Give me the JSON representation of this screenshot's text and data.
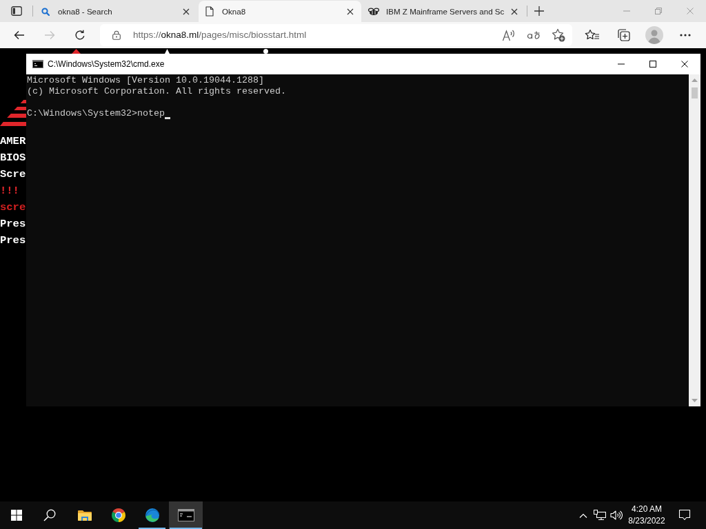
{
  "browser": {
    "tabs": [
      {
        "kind": "search",
        "title": "okna8 - Search",
        "selected": false
      },
      {
        "kind": "page",
        "title": "Okna8",
        "selected": true
      },
      {
        "kind": "site",
        "title": "IBM Z Mainframe Servers and Sc",
        "selected": false
      }
    ],
    "nav_buttons": [
      {
        "kind": "back",
        "disabled": false
      },
      {
        "kind": "forward",
        "disabled": true
      },
      {
        "kind": "refresh",
        "disabled": false
      }
    ],
    "address": {
      "scheme": "https://",
      "host": "okna8.ml",
      "path": "/pages/misc/biosstart.html"
    }
  },
  "page": {
    "lines": [
      {
        "text": "AMER",
        "color": "#ffffff"
      },
      {
        "text": "BIOS",
        "color": "#ffffff"
      },
      {
        "text": "Scre",
        "color": "#ffffff"
      },
      {
        "text": "!!!",
        "color": "#e0262b"
      },
      {
        "text": "scre",
        "color": "#d42020"
      },
      {
        "text": "Pres",
        "color": "#ffffff"
      },
      {
        "text": "Pres",
        "color": "#ffffff"
      }
    ]
  },
  "cmd_window": {
    "title": "C:\\Windows\\System32\\cmd.exe",
    "output": [
      "Microsoft Windows [Version 10.0.19044.1288]",
      "(c) Microsoft Corporation. All rights reserved."
    ],
    "prompt": "C:\\Windows\\System32>notep"
  },
  "taskbar": {
    "apps": [
      {
        "kind": "explorer",
        "running": false,
        "active": false
      },
      {
        "kind": "chrome",
        "running": false,
        "active": false
      },
      {
        "kind": "edge",
        "running": true,
        "active": false
      },
      {
        "kind": "cmd",
        "running": true,
        "active": true
      }
    ],
    "clock": {
      "time": "4:20 AM",
      "date": "8/23/2022"
    }
  }
}
